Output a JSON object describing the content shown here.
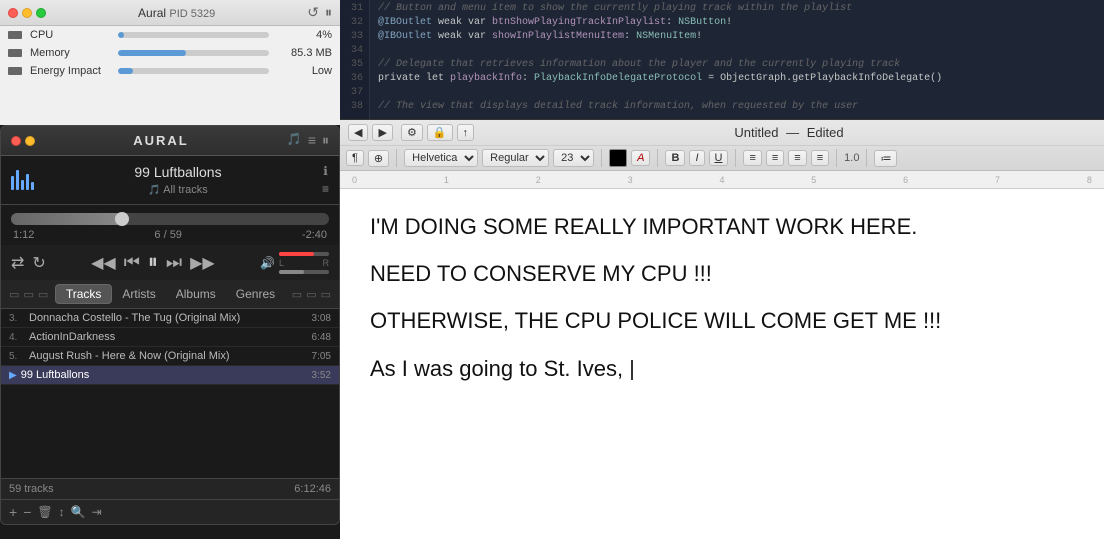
{
  "activity_monitor": {
    "app_name": "Aural",
    "pid": "PID 5329",
    "metrics": [
      {
        "name": "CPU",
        "value": "4%",
        "bar_width": "4"
      },
      {
        "name": "Memory",
        "value": "85.3 MB",
        "bar_width": "45"
      },
      {
        "name": "Energy Impact",
        "value": "Low",
        "bar_width": "10"
      }
    ]
  },
  "aural": {
    "title": "AURAL",
    "now_playing": "99 Luftballons",
    "playlist": "All tracks",
    "time_elapsed": "1:12",
    "position": "6 / 59",
    "time_remaining": "-2:40",
    "progress_percent": 35,
    "tabs": [
      "Tracks",
      "Artists",
      "Albums",
      "Genres"
    ],
    "active_tab": "Tracks",
    "tracks": [
      {
        "num": "3.",
        "name": "Donnacha Costello - The Tug (Original Mix)",
        "duration": "3:08",
        "active": false
      },
      {
        "num": "4.",
        "name": "ActionInDarkness",
        "duration": "6:48",
        "active": false
      },
      {
        "num": "5.",
        "name": "August Rush - Here & Now (Original Mix)",
        "duration": "7:05",
        "active": false
      },
      {
        "num": "▶",
        "name": "99 Luftballons",
        "duration": "3:52",
        "active": true
      }
    ],
    "footer_info": "59 tracks",
    "footer_duration": "6:12:46"
  },
  "code_editor": {
    "title": "Untitled",
    "status": "Edited",
    "font": "Helvetica",
    "style": "Regular",
    "size": "23",
    "line_height": "1.0",
    "code_lines": [
      {
        "num": "31",
        "text": "// Button and menu item to show the currently playing track within the playlist",
        "type": "comment"
      },
      {
        "num": "32",
        "text": "@IBOutlet weak var btnShowPlayingTrackInPlaylist: NSButton!",
        "type": "code"
      },
      {
        "num": "33",
        "text": "@IBOutlet weak var showInPlaylistMenuItem: NSMenuItem!",
        "type": "code"
      },
      {
        "num": "34",
        "text": "",
        "type": "empty"
      },
      {
        "num": "35",
        "text": "// Delegate that retrieves information about the player and the currently playing track",
        "type": "comment"
      },
      {
        "num": "36",
        "text": "private let playbackInfo: PlaybackInfoDelegateProtocol = ObjectGraph.getPlaybackInfoDelegate()",
        "type": "code"
      },
      {
        "num": "37",
        "text": "",
        "type": "empty"
      },
      {
        "num": "38",
        "text": "// The view that displays detailed track information, when requested by the user",
        "type": "comment"
      }
    ],
    "editor_text": [
      "I'M DOING SOME REALLY IMPORTANT WORK HERE.",
      "",
      "NEED TO CONSERVE MY CPU !!!",
      "",
      "OTHERWISE, THE CPU POLICE WILL COME GET ME !!!",
      "",
      "As I was going to St. Ives,"
    ]
  },
  "icons": {
    "close": "✕",
    "minus": "−",
    "refresh": "↺",
    "pause": "⏸",
    "info": "ℹ",
    "list": "≡",
    "rewind": "⏮",
    "back": "◀◀",
    "play": "▶",
    "forward": "▶▶",
    "fastforward": "⏭",
    "shuffle": "⇄",
    "repeat": "↻",
    "volume": "🔊",
    "bold": "B",
    "italic": "I",
    "underline": "U",
    "add": "+",
    "remove": "−",
    "delete": "🗑",
    "move": "↕",
    "search": "🔍"
  }
}
